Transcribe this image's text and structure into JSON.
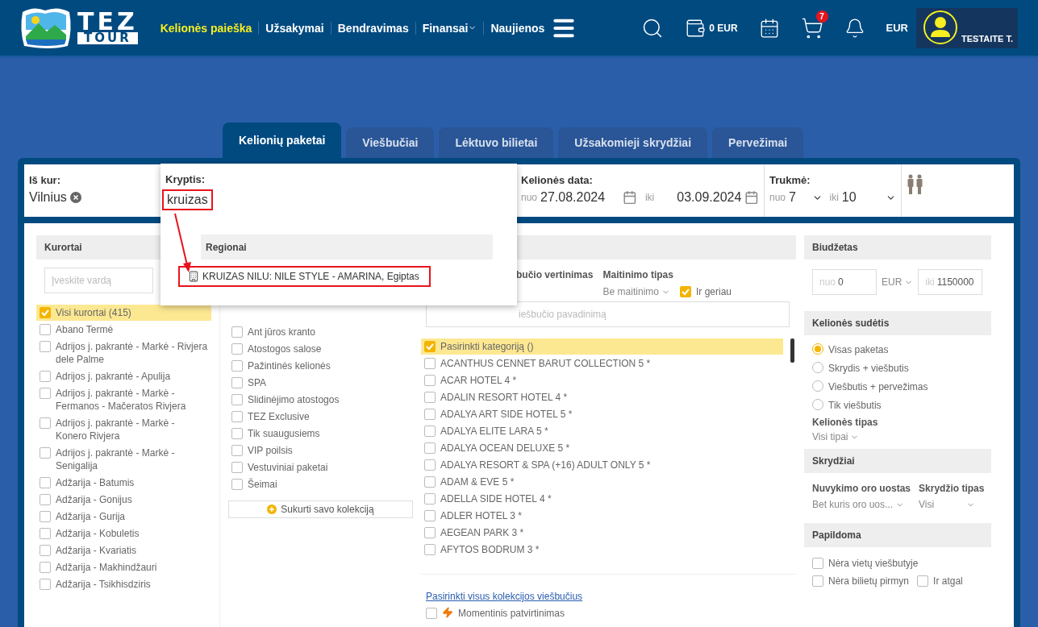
{
  "header": {
    "logo": {
      "line1": "TEZ",
      "line2": "TOUR"
    },
    "nav": [
      {
        "label": "Kelionės paieška",
        "selected": true,
        "caret": false
      },
      {
        "label": "Užsakymai",
        "selected": false,
        "caret": false
      },
      {
        "label": "Bendravimas",
        "selected": false,
        "caret": false
      },
      {
        "label": "Finansai",
        "selected": false,
        "caret": true
      },
      {
        "label": "Naujienos",
        "selected": false,
        "caret": false
      }
    ],
    "wallet": "0 EUR",
    "cart_count": "7",
    "currency": "EUR",
    "user": "TESTAITE T."
  },
  "tabs": [
    {
      "label": "Kelionių paketai",
      "selected": true
    },
    {
      "label": "Viešbučiai",
      "selected": false
    },
    {
      "label": "Lėktuvo bilietai",
      "selected": false
    },
    {
      "label": "Užsakomieji skrydžiai",
      "selected": false
    },
    {
      "label": "Pervežimai",
      "selected": false
    }
  ],
  "search": {
    "from": {
      "label": "Iš kur:",
      "value": "Vilnius"
    },
    "destination": {
      "label": "Kryptis:",
      "value": "kruizas"
    },
    "dates": {
      "label": "Kelionės data:",
      "from_prefix": "nuo",
      "from": "27.08.2024",
      "to_prefix": "iki",
      "to": "03.09.2024"
    },
    "duration": {
      "label": "Trukmė:",
      "from_prefix": "nuo",
      "from": "7",
      "to_prefix": "iki",
      "to": "10"
    }
  },
  "dropdown": {
    "group": "Regionai",
    "results": [
      {
        "text": "KRUIZAS NILU: NILE STYLE - AMARINA, Egiptas"
      }
    ]
  },
  "resorts": {
    "title": "Kurortai",
    "placeholder": "Įveskite vardą",
    "items": [
      {
        "label": "Visi kurortai (415)",
        "checked": true
      },
      {
        "label": "Abano Termė",
        "checked": false
      },
      {
        "label": "Adrijos j. pakrantė - Markė - Rivjera dele Palme",
        "checked": false
      },
      {
        "label": "Adrijos j. pakrantė - Apulija",
        "checked": false
      },
      {
        "label": "Adrijos j. pakrantė - Markė - Fermanos - Mačeratos Rivjera",
        "checked": false
      },
      {
        "label": "Adrijos j. pakrantė - Markė - Konero Rivjera",
        "checked": false
      },
      {
        "label": "Adrijos j. pakrantė - Markė - Senigalija",
        "checked": false
      },
      {
        "label": "Adžarija - Batumis",
        "checked": false
      },
      {
        "label": "Adžarija - Gonijus",
        "checked": false
      },
      {
        "label": "Adžarija - Gurija",
        "checked": false
      },
      {
        "label": "Adžarija - Kobuletis",
        "checked": false
      },
      {
        "label": "Adžarija - Kvariatis",
        "checked": false
      },
      {
        "label": "Adžarija - Makhindžauri",
        "checked": false
      },
      {
        "label": "Adžarija - Tsikhisdziris",
        "checked": false
      }
    ]
  },
  "collections": {
    "items": [
      {
        "label": "Ant jūros kranto",
        "checked": false
      },
      {
        "label": "Atostogos salose",
        "checked": false
      },
      {
        "label": "Pažintinės kelionės",
        "checked": false
      },
      {
        "label": "SPA",
        "checked": false
      },
      {
        "label": "Slidinėjimo atostogos",
        "checked": false
      },
      {
        "label": "TEZ Exclusive",
        "checked": false
      },
      {
        "label": "Tik suaugusiems",
        "checked": false
      },
      {
        "label": "VIP poilsis",
        "checked": false
      },
      {
        "label": "Vestuviniai paketai",
        "checked": false
      },
      {
        "label": "Šeimai",
        "checked": false
      }
    ],
    "button": "Sukurti savo kolekciją"
  },
  "hotels": {
    "rating_label": "bučio vertinimas",
    "meal_label": "Maitinimo tipas",
    "meal_value": "Be maitinimo",
    "better": {
      "label": "Ir geriau",
      "checked": true
    },
    "search_placeholder": "iešbučio pavadinimą",
    "items": [
      {
        "label": "Pasirinkti kategoriją ()",
        "checked": true
      },
      {
        "label": "ACANTHUS CENNET BARUT COLLECTION 5 *",
        "checked": false
      },
      {
        "label": "ACAR HOTEL 4 *",
        "checked": false
      },
      {
        "label": "ADALIN RESORT HOTEL 4 *",
        "checked": false
      },
      {
        "label": "ADALYA ART SIDE HOTEL 5 *",
        "checked": false
      },
      {
        "label": "ADALYA ELITE LARA 5 *",
        "checked": false
      },
      {
        "label": "ADALYA OCEAN DELUXE 5 *",
        "checked": false
      },
      {
        "label": "ADALYA RESORT & SPA (+16) ADULT ONLY 5 *",
        "checked": false
      },
      {
        "label": "ADAM & EVE 5 *",
        "checked": false
      },
      {
        "label": "ADELLA SIDE HOTEL 4 *",
        "checked": false
      },
      {
        "label": "ADLER HOTEL 3 *",
        "checked": false
      },
      {
        "label": "AEGEAN PARK 3 *",
        "checked": false
      },
      {
        "label": "AFYTOS BODRUM 3 *",
        "checked": false
      }
    ],
    "select_all": "Pasirinkti visus kolekcijos viešbučius",
    "instant": {
      "label": "Momentinis patvirtinimas",
      "checked": false
    }
  },
  "budget": {
    "title": "Biudžetas",
    "from_placeholder": "nuo",
    "from": "0",
    "currency": "EUR",
    "to_placeholder": "iki",
    "to": "1150000"
  },
  "composition": {
    "title": "Kelionės sudėtis",
    "options": [
      {
        "label": "Visas paketas",
        "selected": true
      },
      {
        "label": "Skrydis + viešbutis",
        "selected": false
      },
      {
        "label": "Viešbutis + pervežimas",
        "selected": false
      },
      {
        "label": "Tik viešbutis",
        "selected": false
      }
    ],
    "type_label": "Kelionės tipas",
    "type_value": "Visi tipai"
  },
  "flights": {
    "title": "Skrydžiai",
    "airport_label": "Nuvykimo oro uostas",
    "airport_value": "Bet kuris oro uos...",
    "type_label": "Skrydžio tipas",
    "type_value": "Visi"
  },
  "extra": {
    "title": "Papildoma",
    "items": [
      {
        "label": "Nėra vietų viešbutyje",
        "checked": false
      },
      {
        "label": "Nėra bilietų pirmyn",
        "checked": false
      }
    ],
    "return": {
      "label": "Ir atgal",
      "checked": false
    }
  }
}
